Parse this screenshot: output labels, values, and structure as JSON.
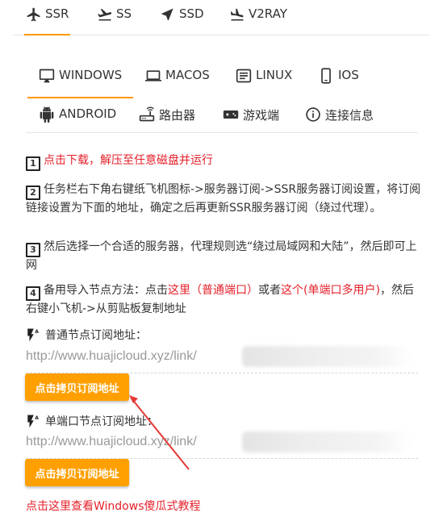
{
  "protocol_tabs": [
    {
      "label": "SSR",
      "icon": "airplane-takeoff-icon",
      "active": true
    },
    {
      "label": "SS",
      "icon": "airplane-landing-icon",
      "active": false
    },
    {
      "label": "SSD",
      "icon": "navigation-arrow-icon",
      "active": false
    },
    {
      "label": "V2RAY",
      "icon": "airplane-landing-icon",
      "active": false
    }
  ],
  "os_tabs": [
    {
      "label": "WINDOWS",
      "icon": "desktop-monitor-icon",
      "active": true
    },
    {
      "label": "MACOS",
      "icon": "laptop-icon",
      "active": false
    },
    {
      "label": "LINUX",
      "icon": "terminal-icon",
      "active": false
    },
    {
      "label": "IOS",
      "icon": "phone-icon",
      "active": false
    },
    {
      "label": "ANDROID",
      "icon": "android-icon",
      "active": false
    },
    {
      "label": "路由器",
      "icon": "router-icon",
      "active": false
    },
    {
      "label": "游戏端",
      "icon": "gamepad-icon",
      "active": false
    },
    {
      "label": "连接信息",
      "icon": "info-icon",
      "active": false
    }
  ],
  "steps": {
    "s1": {
      "num": "1",
      "text": "点击下载，解压至任意磁盘并运行"
    },
    "s2": {
      "num": "2",
      "text": "任务栏右下角右键纸飞机图标->服务器订阅->SSR服务器订阅设置，将订阅链接设置为下面的地址，确定之后再更新SSR服务器订阅（绕过代理）。"
    },
    "s3": {
      "num": "3",
      "text": "然后选择一个合适的服务器，代理规则选“绕过局域网和大陆”，然后即可上网"
    },
    "s4": {
      "num": "4",
      "prefix": "备用导入节点方法：点击",
      "link1": "这里（普通端口）",
      "mid": "或者",
      "link2": "这个(单端口多用户)",
      "suffix": "，然后右键小飞机->从剪贴板复制地址"
    }
  },
  "subscriptions": {
    "normal": {
      "label": "普通节点订阅地址：",
      "url": "http://www.huajicloud.xyz/link/",
      "button": "点击拷贝订阅地址"
    },
    "single": {
      "label": "单端口节点订阅地址：",
      "url": "http://www.huajicloud.xyz/link/",
      "button": "点击拷贝订阅地址"
    }
  },
  "tutorial_link": "点击这里查看Windows傻瓜式教程",
  "colors": {
    "accent": "#ffa000",
    "link_red": "#e5202a",
    "arrow_red": "#e53935"
  }
}
